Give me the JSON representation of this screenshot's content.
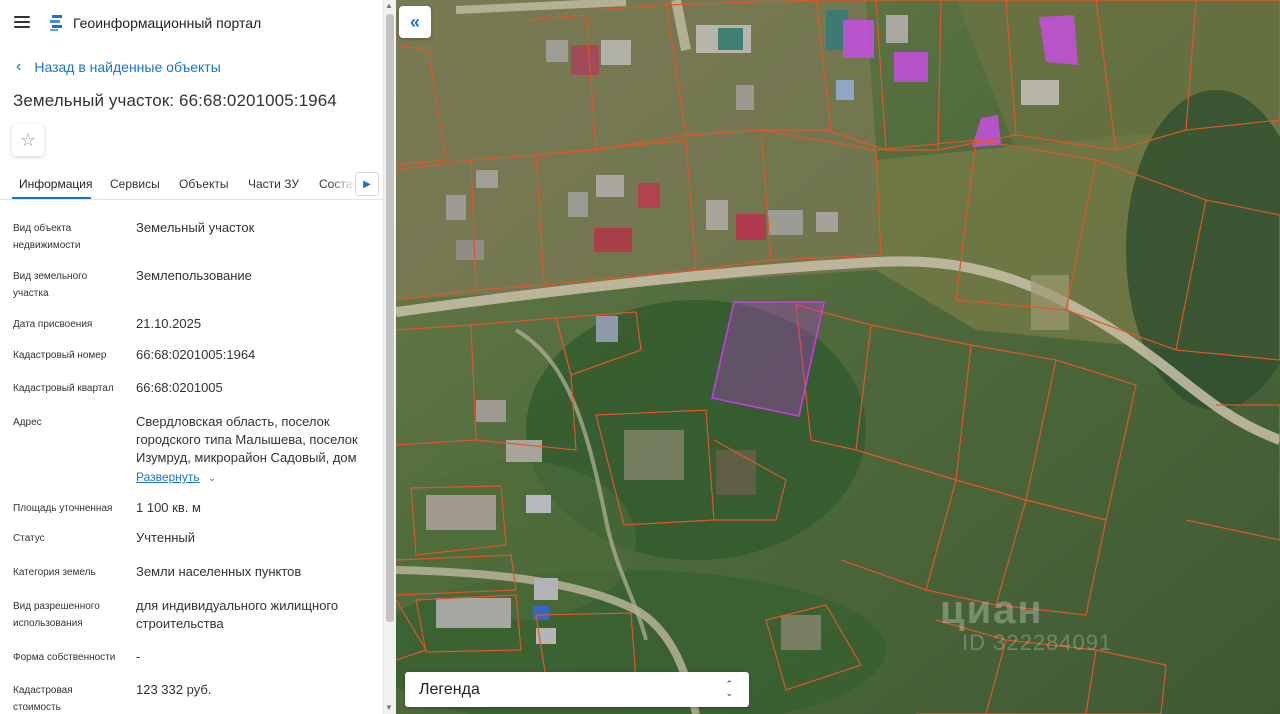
{
  "header": {
    "app_title": "Геоинформационный портал"
  },
  "nav": {
    "back_label": "Назад в найденные объекты"
  },
  "object": {
    "title": "Земельный участок: 66:68:0201005:1964"
  },
  "tabs": [
    {
      "label": "Информация",
      "active": true
    },
    {
      "label": "Сервисы"
    },
    {
      "label": "Объекты"
    },
    {
      "label": "Части ЗУ"
    },
    {
      "label": "Состав"
    }
  ],
  "properties": [
    {
      "label": "Вид объекта недвижимости",
      "value": "Земельный участок"
    },
    {
      "label": "Вид земельного участка",
      "value": "Землепользование"
    },
    {
      "label": "Дата присвоения",
      "value": "21.10.2025"
    },
    {
      "label": "Кадастровый номер",
      "value": "66:68:0201005:1964"
    },
    {
      "label": "Кадастровый квартал",
      "value": "66:68:0201005"
    },
    {
      "label": "Адрес",
      "value": "Свердловская область, поселок городского типа Малышева, поселок Изумруд, микрорайон Садовый, дом"
    },
    {
      "label": "Площадь уточненная",
      "value": "1 100 кв. м"
    },
    {
      "label": "Статус",
      "value": "Учтенный"
    },
    {
      "label": "Категория земель",
      "value": "Земли населенных пунктов"
    },
    {
      "label": "Вид разрешенного использования",
      "value": "для индивидуального жилищного строительства"
    },
    {
      "label": "Форма собственности",
      "value": "-"
    },
    {
      "label": "Кадастровая стоимость",
      "value": "123 332 руб."
    }
  ],
  "address_expand_label": "Развернуть",
  "map": {
    "legend_label": "Легенда",
    "watermark": "циан",
    "watermark_id": "ID 322284091",
    "colors": {
      "parcel_border": "#e0562a",
      "selected_parcel": "#b43cd2",
      "building_highlight": "#c84fe0",
      "accent": "#1a73c8"
    }
  }
}
